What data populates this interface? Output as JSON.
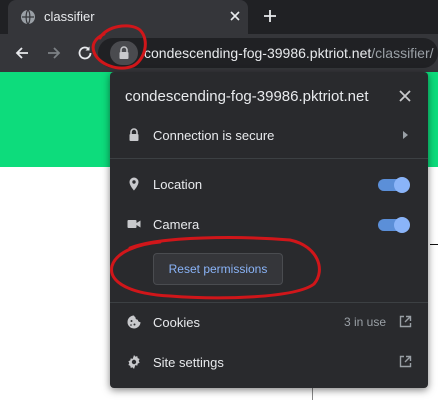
{
  "tab": {
    "title": "classifier",
    "favicon": "globe-icon",
    "close_icon": "close-icon",
    "new_tab_icon": "plus-icon"
  },
  "toolbar": {
    "back_icon": "arrow-left-icon",
    "forward_icon": "arrow-right-icon",
    "reload_icon": "reload-icon",
    "url_host": "condescending-fog-39986.pktriot.net",
    "url_path": "/classifier/",
    "lock_icon": "lock-icon"
  },
  "popup": {
    "site": "condescending-fog-39986.pktriot.net",
    "connection": {
      "label": "Connection is secure",
      "icon": "lock-icon"
    },
    "permissions": [
      {
        "label": "Location",
        "icon": "location-pin-icon",
        "enabled": true
      },
      {
        "label": "Camera",
        "icon": "camera-icon",
        "enabled": true
      }
    ],
    "reset_label": "Reset permissions",
    "cookies": {
      "label": "Cookies",
      "count": "3 in use",
      "icon": "cookie-icon"
    },
    "site_settings": {
      "label": "Site settings",
      "icon": "gear-icon"
    }
  },
  "colors": {
    "page_banner": "#0ddc7c",
    "annotation": "#d0161a",
    "toggle_on": "#8ab4f8"
  }
}
